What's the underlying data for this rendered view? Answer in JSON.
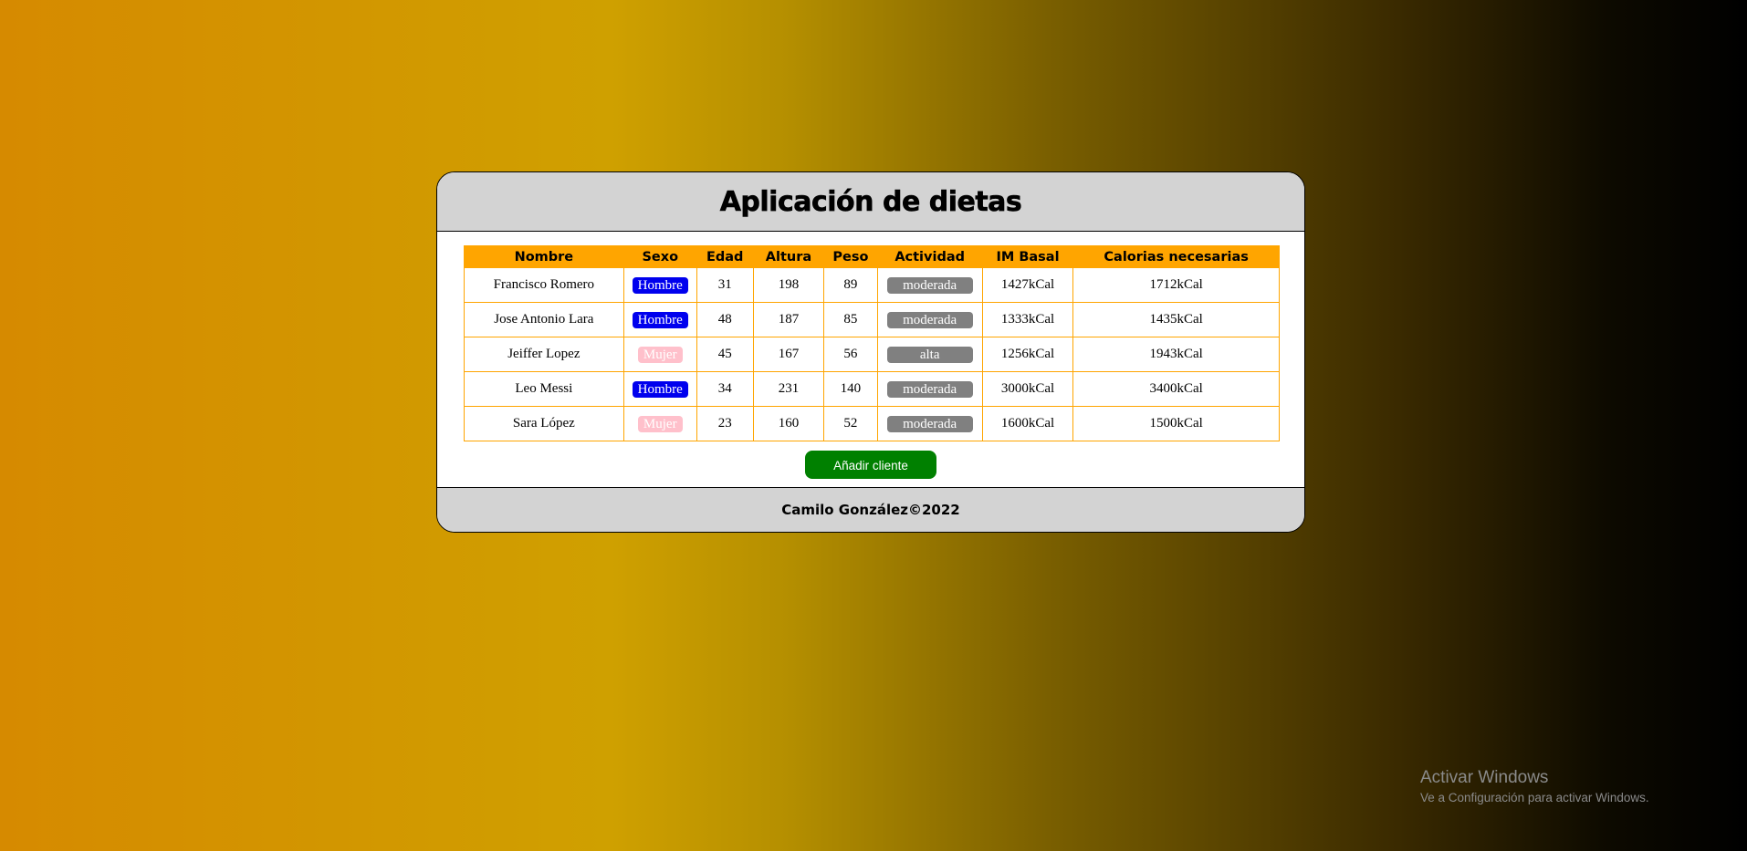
{
  "app": {
    "title": "Aplicación de dietas",
    "footer": "Camilo González©2022"
  },
  "table": {
    "headers": [
      "Nombre",
      "Sexo",
      "Edad",
      "Altura",
      "Peso",
      "Actividad",
      "IM Basal",
      "Calorias necesarias"
    ],
    "rows": [
      {
        "nombre": "Francisco Romero",
        "sexo": "Hombre",
        "edad": "31",
        "altura": "198",
        "peso": "89",
        "actividad": "moderada",
        "imbasal": "1427kCal",
        "calorias": "1712kCal"
      },
      {
        "nombre": "Jose Antonio Lara",
        "sexo": "Hombre",
        "edad": "48",
        "altura": "187",
        "peso": "85",
        "actividad": "moderada",
        "imbasal": "1333kCal",
        "calorias": "1435kCal"
      },
      {
        "nombre": "Jeiffer Lopez",
        "sexo": "Mujer",
        "edad": "45",
        "altura": "167",
        "peso": "56",
        "actividad": "alta",
        "imbasal": "1256kCal",
        "calorias": "1943kCal"
      },
      {
        "nombre": "Leo Messi",
        "sexo": "Hombre",
        "edad": "34",
        "altura": "231",
        "peso": "140",
        "actividad": "moderada",
        "imbasal": "3000kCal",
        "calorias": "3400kCal"
      },
      {
        "nombre": "Sara López",
        "sexo": "Mujer",
        "edad": "23",
        "altura": "160",
        "peso": "52",
        "actividad": "moderada",
        "imbasal": "1600kCal",
        "calorias": "1500kCal"
      }
    ]
  },
  "actions": {
    "add_label": "Añadir cliente"
  },
  "watermark": {
    "title": "Activar Windows",
    "subtitle": "Ve a Configuración para activar Windows."
  },
  "colors": {
    "header_bg": "#ffa500",
    "hombre_badge": "#0000ee",
    "mujer_badge": "#ffc0cb",
    "activity_badge": "#808080",
    "add_button": "#008000",
    "card_header": "#d3d3d3"
  }
}
